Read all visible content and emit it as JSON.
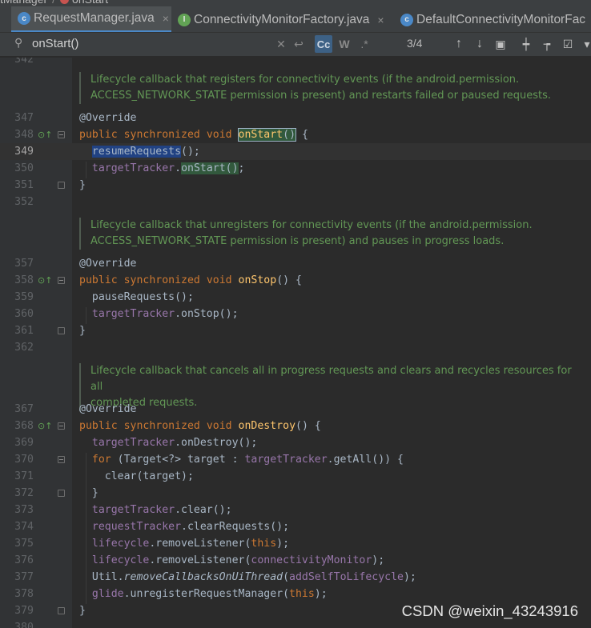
{
  "breadcrumb": {
    "class_label": "tManager",
    "method_label": "onStart"
  },
  "tabs": [
    {
      "label": "RequestManager.java",
      "close": "×",
      "icon": "c-class-icon",
      "icon_letter": "c"
    },
    {
      "label": "ConnectivityMonitorFactory.java",
      "close": "×",
      "icon": "i-interface-icon",
      "icon_letter": "I"
    },
    {
      "label": "DefaultConnectivityMonitorFac",
      "icon": "c-class-icon",
      "icon_letter": "c"
    }
  ],
  "search": {
    "query": "onStart()",
    "match_case_label": "Cc",
    "words_label": "W",
    "regex_label": ".*",
    "match_count": "3/4"
  },
  "editor": {
    "first_line_partial": "342",
    "docs": [
      {
        "line1": "Lifecycle callback that registers for connectivity events (if the android.permission.",
        "line2": "ACCESS_NETWORK_STATE permission is present) and restarts failed or paused requests."
      },
      {
        "line1": "Lifecycle callback that unregisters for connectivity events (if the android.permission.",
        "line2": "ACCESS_NETWORK_STATE permission is present) and pauses in progress loads."
      },
      {
        "line1": "Lifecycle callback that cancels all in progress requests and clears and recycles resources for all",
        "line2": "completed requests."
      }
    ],
    "line_numbers": [
      "347",
      "348",
      "349",
      "350",
      "351",
      "352",
      "357",
      "358",
      "359",
      "360",
      "361",
      "362",
      "367",
      "368",
      "369",
      "370",
      "371",
      "372",
      "373",
      "374",
      "375",
      "376",
      "377",
      "378",
      "379",
      "380"
    ],
    "current_line": "349"
  },
  "code": {
    "override": "@Override",
    "public": "public",
    "synchronized": "synchronized",
    "void": "void",
    "on_start": "onStart",
    "on_stop": "onStop",
    "on_destroy": "onDestroy",
    "parens": "()",
    "open_brace": " {",
    "close_brace": "}",
    "resume_requests": "resumeRequests",
    "call_end": "();",
    "target_tracker": "targetTracker",
    "dot": ".",
    "on_start_call": "onStart()",
    "semicolon": ";",
    "pause_requests": "pauseRequests",
    "on_stop_call": ".onStop();",
    "on_destroy_call": ".onDestroy();",
    "for": "for",
    "for_middle": " (Target<?> target : ",
    "get_all": ".getAll()) {",
    "clear_target": "clear(target);",
    "clear_call": ".clear();",
    "request_tracker": "requestTracker",
    "clear_requests": ".clearRequests();",
    "lifecycle": "lifecycle",
    "remove_listener_open": ".removeListener(",
    "this": "this",
    "close_call": ");",
    "connectivity_monitor": "connectivityMonitor",
    "util": "Util.",
    "remove_callbacks": "removeCallbacksOnUiThread",
    "open_paren": "(",
    "add_self": "addSelfToLifecycle",
    "glide": "glide",
    "unregister": ".unregisterRequestManager("
  },
  "watermark": "CSDN @weixin_43243916",
  "colors": {
    "background": "#2b2b2b",
    "keyword": "#cc7832",
    "annotation": "#bbb529",
    "method": "#ffc66d",
    "field": "#9876aa",
    "doc_comment": "#629755",
    "search_match": "#32593d",
    "selection": "#214283"
  }
}
